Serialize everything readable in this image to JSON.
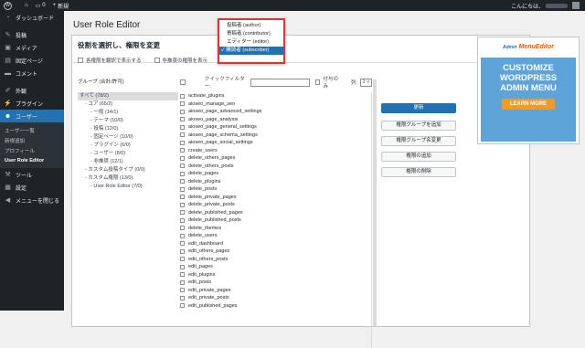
{
  "adminbar": {
    "site_icon": "home-icon",
    "comments_count": "0",
    "new_label": "新規",
    "greeting": "こんにちは、"
  },
  "sidebar": {
    "items": [
      {
        "label": "ダッシュボード",
        "icon": "dashboard-icon"
      },
      {
        "label": "投稿",
        "icon": "pin-icon"
      },
      {
        "label": "メディア",
        "icon": "media-icon"
      },
      {
        "label": "固定ページ",
        "icon": "page-icon"
      },
      {
        "label": "コメント",
        "icon": "comment-icon"
      },
      {
        "label": "外観",
        "icon": "brush-icon"
      },
      {
        "label": "プラグイン",
        "icon": "plugin-icon"
      },
      {
        "label": "ユーザー",
        "icon": "users-icon"
      },
      {
        "label": "ツール",
        "icon": "wrench-icon"
      },
      {
        "label": "設定",
        "icon": "settings-icon"
      },
      {
        "label": "メニューを閉じる",
        "icon": "collapse-icon"
      }
    ],
    "submenu": [
      "ユーザー一覧",
      "新規追加",
      "プロフィール",
      "User Role Editor"
    ]
  },
  "page": {
    "title": "User Role Editor",
    "heading": "役割を選択し、権限を変更",
    "opt_show_caps": "各権限を翻訳で表示する",
    "opt_show_deprecated": "非推奨の権限を表示"
  },
  "role_dropdown": {
    "options": [
      "投稿者 (author)",
      "寄稿者 (contributor)",
      "エディター (editor)",
      "購読者 (subscriber)"
    ],
    "selected_mark": "✓"
  },
  "groups": {
    "header": "グループ",
    "header_count": "(合計/許可)",
    "items": [
      "すべて (78/2)",
      "- コア (65/2)",
      "- 一般 (14/1)",
      "- テーマ (10/0)",
      "- 投稿 (12/0)",
      "- 固定ページ (10/0)",
      "- プラグイン (6/0)",
      "- ユーザー (8/0)",
      "- 非推奨 (12/1)",
      "- カスタム投稿タイプ (0/0)",
      "- カスタム権限 (13/0)",
      "- User Role Editor (7/0)"
    ]
  },
  "caps": {
    "filter_label": "クイックフィルター:",
    "granted_only": "付与のみ",
    "columns_label": "列:",
    "columns_value": "1",
    "items": [
      "activate_plugins",
      "aioseo_manage_seo",
      "aioseo_page_advanced_settings",
      "aioseo_page_analysis",
      "aioseo_page_general_settings",
      "aioseo_page_schema_settings",
      "aioseo_page_social_settings",
      "create_users",
      "delete_others_pages",
      "delete_others_posts",
      "delete_pages",
      "delete_plugins",
      "delete_posts",
      "delete_private_pages",
      "delete_private_posts",
      "delete_published_pages",
      "delete_published_posts",
      "delete_themes",
      "delete_users",
      "edit_dashboard",
      "edit_others_pages",
      "edit_others_posts",
      "edit_pages",
      "edit_plugins",
      "edit_posts",
      "edit_private_pages",
      "edit_private_posts",
      "edit_published_pages"
    ]
  },
  "actions": {
    "update": "更新",
    "add_role": "権限グループを追加",
    "rename_role": "権限グループ名変更",
    "add_cap": "権限の追加",
    "delete_cap": "権限の削除"
  },
  "ad": {
    "logo_a": "Admin",
    "logo_b": "MenuEditor",
    "line1": "CUSTOMIZE",
    "line2": "WORDPRESS",
    "line3": "ADMIN MENU",
    "button": "LEARN MORE"
  },
  "colors": {
    "accent": "#2271b1",
    "highlight_border": "#d63638",
    "sidebar_bg": "#1d2327"
  }
}
